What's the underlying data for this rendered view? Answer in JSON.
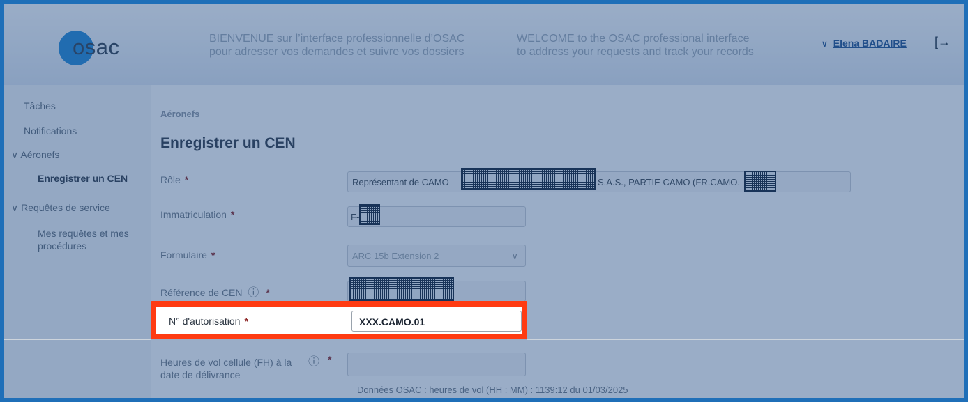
{
  "header": {
    "logo_text": "osac",
    "welcome_fr_line1": "BIENVENUE sur l’interface professionnelle d’OSAC",
    "welcome_fr_line2": "pour adresser vos demandes et suivre vos dossiers",
    "welcome_en_line1": "WELCOME to the OSAC professional interface",
    "welcome_en_line2": "to address your requests and track your records",
    "user_name": "Elena BADAIRE",
    "chevron_glyph": "∨",
    "logout_glyph": "[→"
  },
  "sidebar": {
    "items": [
      {
        "label": "Tâches"
      },
      {
        "label": "Notifications"
      },
      {
        "label": "Aéronefs"
      },
      {
        "label": "Enregistrer un CEN"
      },
      {
        "label": "Requêtes de service"
      },
      {
        "label": "Mes requêtes et mes"
      },
      {
        "label": "procédures"
      }
    ],
    "expand_glyph": "∨"
  },
  "main": {
    "breadcrumb": "Aéronefs",
    "title": "Enregistrer un CEN",
    "required_mark": "*",
    "role_label": "Rôle",
    "role_value_prefix": "Représentant de CAMO",
    "role_value_suffix": "S.A.S., PARTIE CAMO (FR.CAMO.",
    "immat_label": "Immatriculation",
    "immat_value": "F-",
    "form_label": "Formulaire",
    "form_value": "ARC 15b Extension 2",
    "dropdown_glyph": "∨",
    "cen_ref_label": "Référence de CEN",
    "info_glyph": "ⓘ",
    "auth_label": "N° d'autorisation",
    "auth_value": "XXX.CAMO.01",
    "hours_label_line1": "Heures de vol cellule (FH) à la",
    "hours_label_line2": "date de délivrance",
    "hours_value": "",
    "osac_data_note": "Données OSAC : heures de vol (HH : MM) : 1139:12 du 01/03/2025"
  },
  "colors": {
    "highlight": "#ff3b12",
    "overlay": "#285087",
    "accent": "#1b84d4"
  }
}
